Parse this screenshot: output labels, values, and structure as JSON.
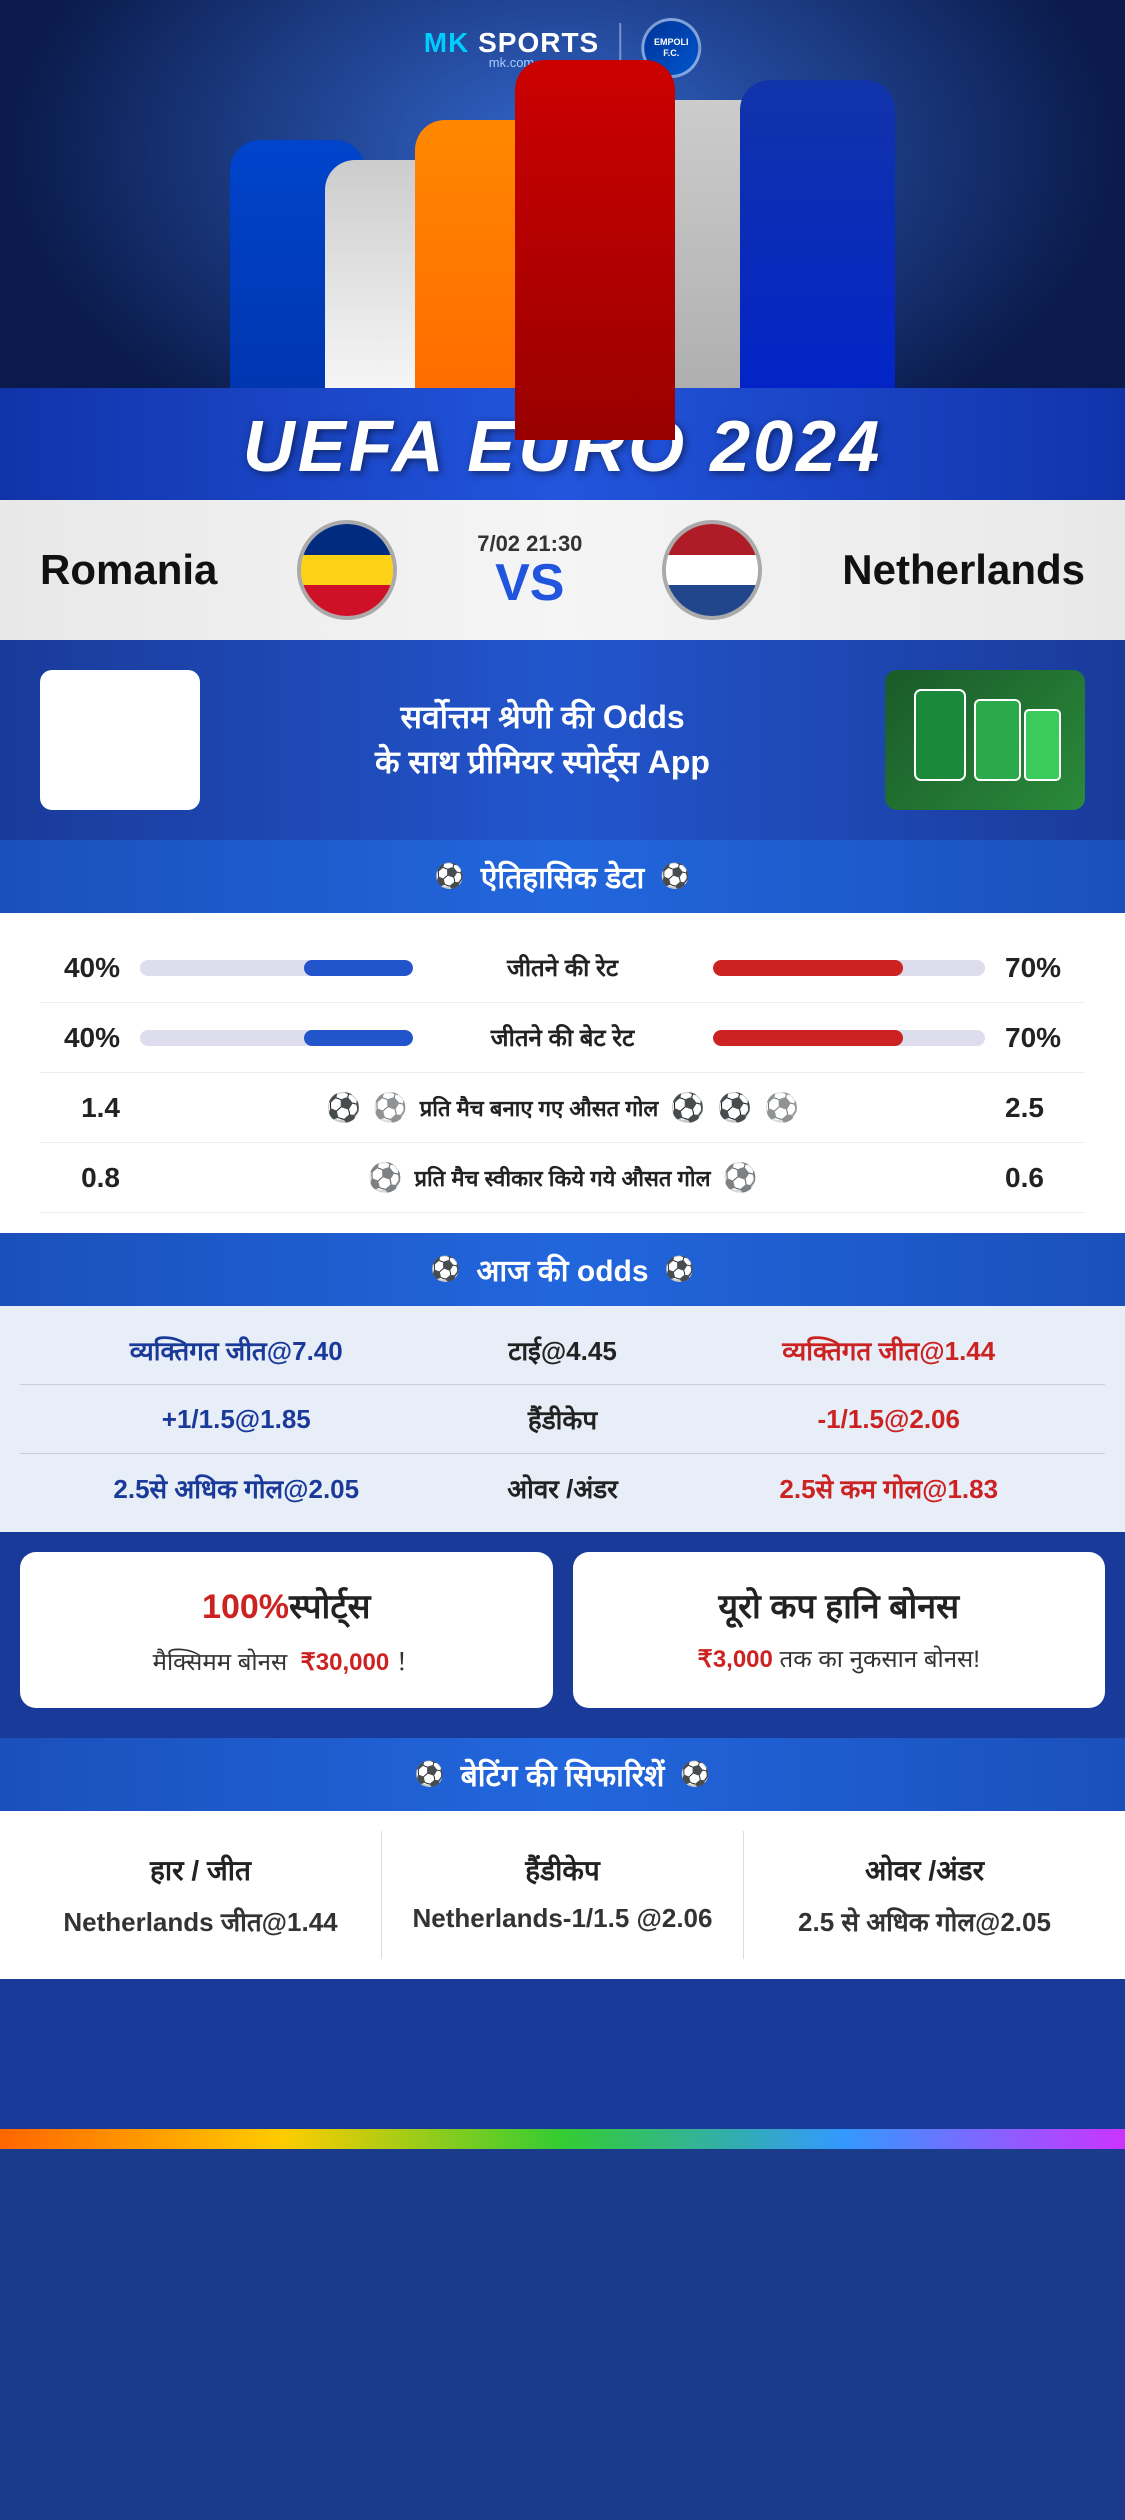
{
  "brand": {
    "mk_logo": "MK SPORTS",
    "mk_sub": "mk.com",
    "divider": "|"
  },
  "hero": {
    "title": "UEFA EURO 2024"
  },
  "match": {
    "team_left": "Romania",
    "team_right": "Netherlands",
    "date": "7/02 21:30",
    "vs": "VS"
  },
  "app_promo": {
    "text_line1": "सर्वोत्तम श्रेणी की",
    "text_odds": "Odds",
    "text_line2": "के साथ प्रीमियर स्पोर्ट्स",
    "text_app": "App"
  },
  "historical": {
    "section_title": "ऐतिहासिक डेटा",
    "win_rate_label": "जीतने की रेट",
    "win_rate_left": "40%",
    "win_rate_right": "70%",
    "win_rate_left_pct": 40,
    "win_rate_right_pct": 70,
    "bet_rate_label": "जीतने की बेट रेट",
    "bet_rate_left": "40%",
    "bet_rate_right": "70%",
    "bet_rate_left_pct": 40,
    "bet_rate_right_pct": 70,
    "avg_goals_label": "प्रति मैच बनाए गए औसत गोल",
    "avg_goals_left": "1.4",
    "avg_goals_right": "2.5",
    "avg_concede_label": "प्रति मैच स्वीकार किये गये औसत गोल",
    "avg_concede_left": "0.8",
    "avg_concede_right": "0.6"
  },
  "odds": {
    "section_title": "आज की odds",
    "win_left_label": "व्यक्तिगत जीत@7.40",
    "tie_label": "टाई@4.45",
    "win_right_label": "व्यक्तिगत जीत@1.44",
    "handicap_left": "+1/1.5@1.85",
    "handicap_label": "हैंडीकेप",
    "handicap_right": "-1/1.5@2.06",
    "over_left": "2.5से अधिक गोल@2.05",
    "over_label": "ओवर /अंडर",
    "over_right": "2.5से कम गोल@1.83"
  },
  "bonuses": {
    "bonus1_title": "100%स्पोर्ट्स",
    "bonus1_highlight": "100%",
    "bonus1_desc": "मैक्सिमम बोनस  ₹30,000 ！",
    "bonus2_title": "यूरो कप हानि बोनस",
    "bonus2_desc": "₹3,000 तक का नुकसान बोनस!"
  },
  "recommendations": {
    "section_title": "बेटिंग की सिफारिशें",
    "card1_title": "हार / जीत",
    "card1_value": "Netherlands जीत@1.44",
    "card2_title": "हैंडीकेप",
    "card2_value": "Netherlands-1/1.5 @2.06",
    "card3_title": "ओवर /अंडर",
    "card3_value": "2.5 से अधिक गोल@2.05"
  }
}
